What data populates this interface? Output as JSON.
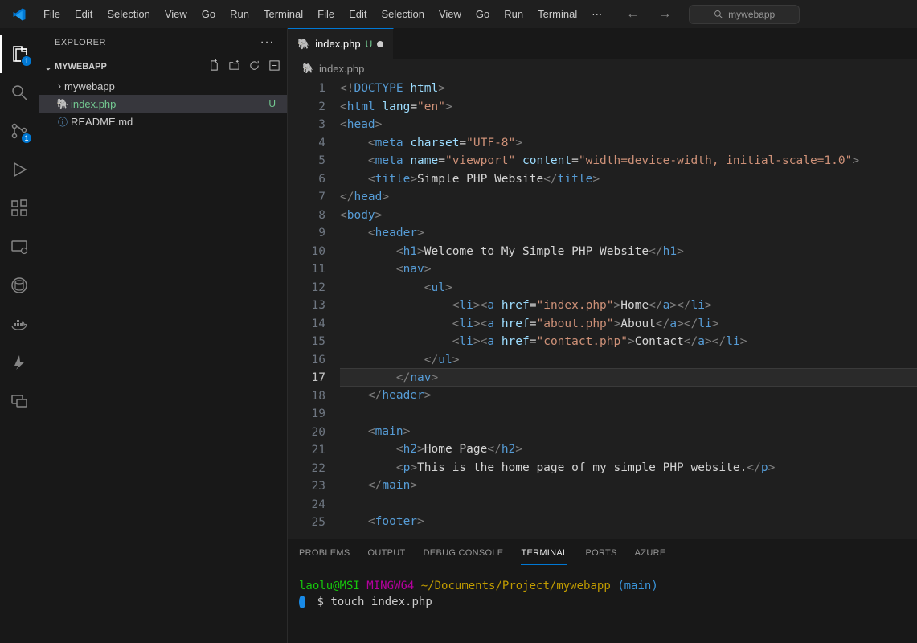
{
  "menu": [
    "File",
    "Edit",
    "Selection",
    "View",
    "Go",
    "Run",
    "Terminal"
  ],
  "search_placeholder": "mywebapp",
  "activity": {
    "explorer_badge": "1",
    "scm_badge": "1"
  },
  "explorer": {
    "title": "EXPLORER",
    "project": "MYWEBAPP",
    "items": [
      {
        "name": "mywebapp",
        "kind": "folder",
        "git": ""
      },
      {
        "name": "index.php",
        "kind": "php",
        "git": "U"
      },
      {
        "name": "README.md",
        "kind": "readme",
        "git": ""
      }
    ]
  },
  "tab": {
    "name": "index.php",
    "git": "U"
  },
  "breadcrumb_file": "index.php",
  "current_line": 17,
  "code_lines": [
    [
      [
        "pun",
        "<!"
      ],
      [
        "tag",
        "DOCTYPE"
      ],
      [
        "txt",
        " "
      ],
      [
        "attr",
        "html"
      ],
      [
        "pun",
        ">"
      ]
    ],
    [
      [
        "pun",
        "<"
      ],
      [
        "tag",
        "html"
      ],
      [
        "txt",
        " "
      ],
      [
        "attr",
        "lang"
      ],
      [
        "txt",
        "="
      ],
      [
        "str",
        "\"en\""
      ],
      [
        "pun",
        ">"
      ]
    ],
    [
      [
        "pun",
        "<"
      ],
      [
        "tag",
        "head"
      ],
      [
        "pun",
        ">"
      ]
    ],
    [
      [
        "txt",
        "    "
      ],
      [
        "pun",
        "<"
      ],
      [
        "tag",
        "meta"
      ],
      [
        "txt",
        " "
      ],
      [
        "attr",
        "charset"
      ],
      [
        "txt",
        "="
      ],
      [
        "str",
        "\"UTF-8\""
      ],
      [
        "pun",
        ">"
      ]
    ],
    [
      [
        "txt",
        "    "
      ],
      [
        "pun",
        "<"
      ],
      [
        "tag",
        "meta"
      ],
      [
        "txt",
        " "
      ],
      [
        "attr",
        "name"
      ],
      [
        "txt",
        "="
      ],
      [
        "str",
        "\"viewport\""
      ],
      [
        "txt",
        " "
      ],
      [
        "attr",
        "content"
      ],
      [
        "txt",
        "="
      ],
      [
        "str",
        "\"width=device-width, initial-scale=1.0\""
      ],
      [
        "pun",
        ">"
      ]
    ],
    [
      [
        "txt",
        "    "
      ],
      [
        "pun",
        "<"
      ],
      [
        "tag",
        "title"
      ],
      [
        "pun",
        ">"
      ],
      [
        "txt",
        "Simple PHP Website"
      ],
      [
        "pun",
        "</"
      ],
      [
        "tag",
        "title"
      ],
      [
        "pun",
        ">"
      ]
    ],
    [
      [
        "pun",
        "</"
      ],
      [
        "tag",
        "head"
      ],
      [
        "pun",
        ">"
      ]
    ],
    [
      [
        "pun",
        "<"
      ],
      [
        "tag",
        "body"
      ],
      [
        "pun",
        ">"
      ]
    ],
    [
      [
        "txt",
        "    "
      ],
      [
        "pun",
        "<"
      ],
      [
        "tag",
        "header"
      ],
      [
        "pun",
        ">"
      ]
    ],
    [
      [
        "txt",
        "        "
      ],
      [
        "pun",
        "<"
      ],
      [
        "tag",
        "h1"
      ],
      [
        "pun",
        ">"
      ],
      [
        "txt",
        "Welcome to My Simple PHP Website"
      ],
      [
        "pun",
        "</"
      ],
      [
        "tag",
        "h1"
      ],
      [
        "pun",
        ">"
      ]
    ],
    [
      [
        "txt",
        "        "
      ],
      [
        "pun",
        "<"
      ],
      [
        "tag",
        "nav"
      ],
      [
        "pun",
        ">"
      ]
    ],
    [
      [
        "txt",
        "            "
      ],
      [
        "pun",
        "<"
      ],
      [
        "tag",
        "ul"
      ],
      [
        "pun",
        ">"
      ]
    ],
    [
      [
        "txt",
        "                "
      ],
      [
        "pun",
        "<"
      ],
      [
        "tag",
        "li"
      ],
      [
        "pun",
        "><"
      ],
      [
        "tag",
        "a"
      ],
      [
        "txt",
        " "
      ],
      [
        "attr",
        "href"
      ],
      [
        "txt",
        "="
      ],
      [
        "str",
        "\"index.php\""
      ],
      [
        "pun",
        ">"
      ],
      [
        "txt",
        "Home"
      ],
      [
        "pun",
        "</"
      ],
      [
        "tag",
        "a"
      ],
      [
        "pun",
        "></"
      ],
      [
        "tag",
        "li"
      ],
      [
        "pun",
        ">"
      ]
    ],
    [
      [
        "txt",
        "                "
      ],
      [
        "pun",
        "<"
      ],
      [
        "tag",
        "li"
      ],
      [
        "pun",
        "><"
      ],
      [
        "tag",
        "a"
      ],
      [
        "txt",
        " "
      ],
      [
        "attr",
        "href"
      ],
      [
        "txt",
        "="
      ],
      [
        "str",
        "\"about.php\""
      ],
      [
        "pun",
        ">"
      ],
      [
        "txt",
        "About"
      ],
      [
        "pun",
        "</"
      ],
      [
        "tag",
        "a"
      ],
      [
        "pun",
        "></"
      ],
      [
        "tag",
        "li"
      ],
      [
        "pun",
        ">"
      ]
    ],
    [
      [
        "txt",
        "                "
      ],
      [
        "pun",
        "<"
      ],
      [
        "tag",
        "li"
      ],
      [
        "pun",
        "><"
      ],
      [
        "tag",
        "a"
      ],
      [
        "txt",
        " "
      ],
      [
        "attr",
        "href"
      ],
      [
        "txt",
        "="
      ],
      [
        "str",
        "\"contact.php\""
      ],
      [
        "pun",
        ">"
      ],
      [
        "txt",
        "Contact"
      ],
      [
        "pun",
        "</"
      ],
      [
        "tag",
        "a"
      ],
      [
        "pun",
        "></"
      ],
      [
        "tag",
        "li"
      ],
      [
        "pun",
        ">"
      ]
    ],
    [
      [
        "txt",
        "            "
      ],
      [
        "pun",
        "</"
      ],
      [
        "tag",
        "ul"
      ],
      [
        "pun",
        ">"
      ]
    ],
    [
      [
        "txt",
        "        "
      ],
      [
        "pun",
        "</"
      ],
      [
        "tag",
        "nav"
      ],
      [
        "pun",
        ">"
      ]
    ],
    [
      [
        "txt",
        "    "
      ],
      [
        "pun",
        "</"
      ],
      [
        "tag",
        "header"
      ],
      [
        "pun",
        ">"
      ]
    ],
    [],
    [
      [
        "txt",
        "    "
      ],
      [
        "pun",
        "<"
      ],
      [
        "tag",
        "main"
      ],
      [
        "pun",
        ">"
      ]
    ],
    [
      [
        "txt",
        "        "
      ],
      [
        "pun",
        "<"
      ],
      [
        "tag",
        "h2"
      ],
      [
        "pun",
        ">"
      ],
      [
        "txt",
        "Home Page"
      ],
      [
        "pun",
        "</"
      ],
      [
        "tag",
        "h2"
      ],
      [
        "pun",
        ">"
      ]
    ],
    [
      [
        "txt",
        "        "
      ],
      [
        "pun",
        "<"
      ],
      [
        "tag",
        "p"
      ],
      [
        "pun",
        ">"
      ],
      [
        "txt",
        "This is the home page of my simple PHP website."
      ],
      [
        "pun",
        "</"
      ],
      [
        "tag",
        "p"
      ],
      [
        "pun",
        ">"
      ]
    ],
    [
      [
        "txt",
        "    "
      ],
      [
        "pun",
        "</"
      ],
      [
        "tag",
        "main"
      ],
      [
        "pun",
        ">"
      ]
    ],
    [],
    [
      [
        "txt",
        "    "
      ],
      [
        "pun",
        "<"
      ],
      [
        "tag",
        "footer"
      ],
      [
        "pun",
        ">"
      ]
    ]
  ],
  "panel_tabs": [
    "PROBLEMS",
    "OUTPUT",
    "DEBUG CONSOLE",
    "TERMINAL",
    "PORTS",
    "AZURE"
  ],
  "panel_active": "TERMINAL",
  "terminal": {
    "user": "laolu@MSI",
    "shell": "MINGW64",
    "cwd": "~/Documents/Project/mywebapp",
    "branch": "(main)",
    "prompt": "$",
    "command": "touch index.php"
  }
}
